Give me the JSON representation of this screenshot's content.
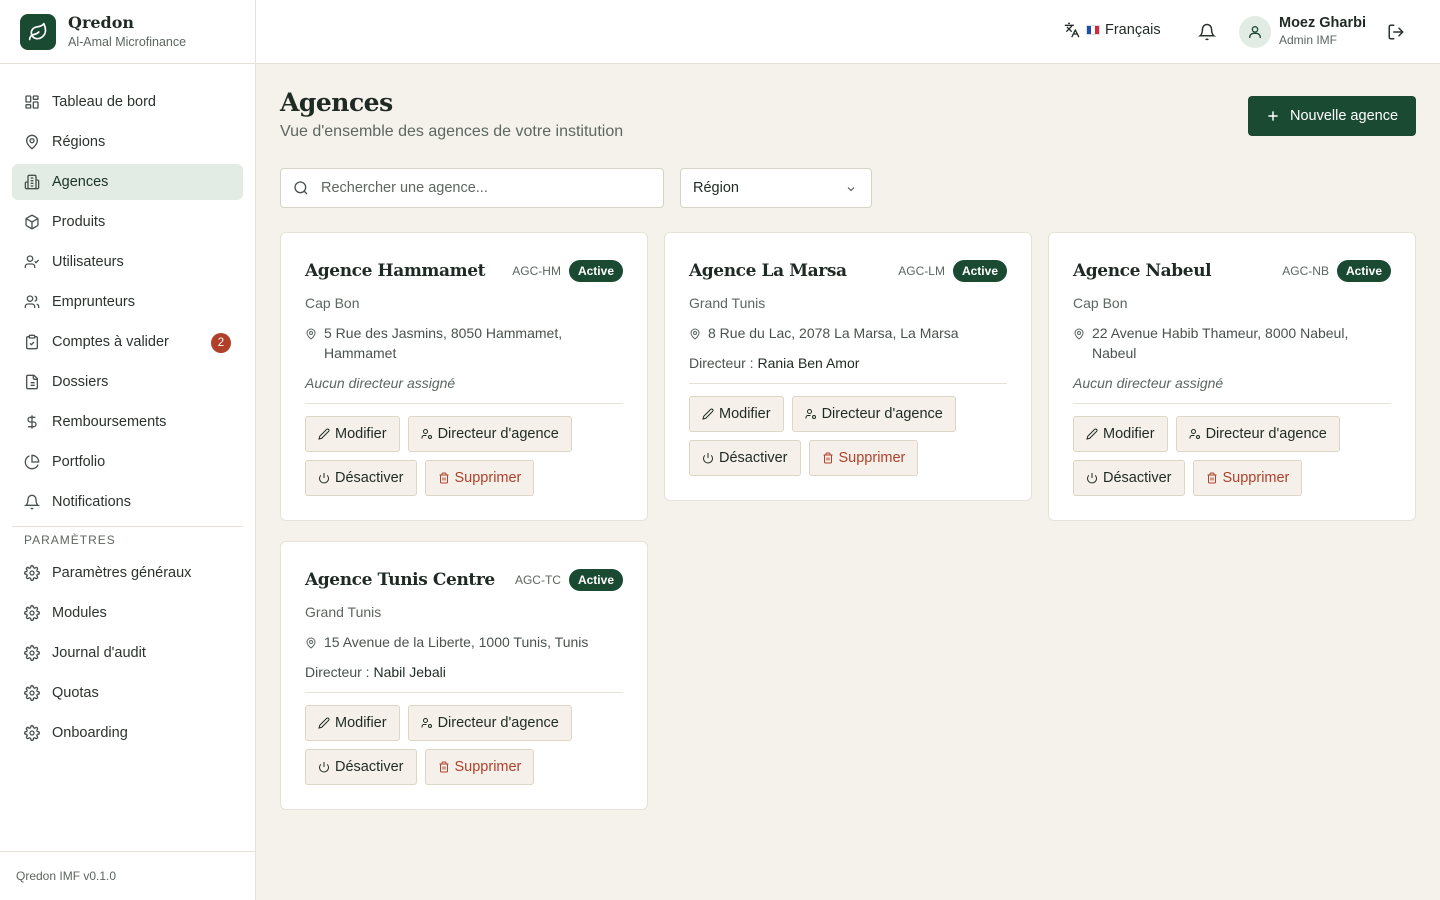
{
  "brand": {
    "name": "Qredon",
    "subtitle": "Al-Amal Microfinance"
  },
  "sidebar": {
    "items": [
      {
        "label": "Tableau de bord",
        "icon": "dashboard-icon"
      },
      {
        "label": "Régions",
        "icon": "map-pin-icon"
      },
      {
        "label": "Agences",
        "icon": "building-icon",
        "active": true
      },
      {
        "label": "Produits",
        "icon": "package-icon"
      },
      {
        "label": "Utilisateurs",
        "icon": "user-check-icon"
      },
      {
        "label": "Emprunteurs",
        "icon": "users-icon"
      },
      {
        "label": "Comptes à valider",
        "icon": "clipboard-check-icon",
        "badge": "2"
      },
      {
        "label": "Dossiers",
        "icon": "file-icon"
      },
      {
        "label": "Remboursements",
        "icon": "dollar-icon"
      },
      {
        "label": "Portfolio",
        "icon": "pie-chart-icon"
      },
      {
        "label": "Notifications",
        "icon": "bell-icon"
      }
    ],
    "settings_heading": "Paramètres",
    "settings_items": [
      {
        "label": "Paramètres généraux",
        "icon": "gear-icon"
      },
      {
        "label": "Modules",
        "icon": "gear-icon"
      },
      {
        "label": "Journal d'audit",
        "icon": "gear-icon"
      },
      {
        "label": "Quotas",
        "icon": "gear-icon"
      },
      {
        "label": "Onboarding",
        "icon": "gear-icon"
      }
    ],
    "footer": "Qredon IMF v0.1.0"
  },
  "topbar": {
    "language": "Français",
    "user_name": "Moez Gharbi",
    "user_role": "Admin IMF"
  },
  "page": {
    "title": "Agences",
    "subtitle": "Vue d'ensemble des agences de votre institution",
    "new_button": "Nouvelle agence",
    "search_placeholder": "Rechercher une agence...",
    "region_filter": "Région"
  },
  "actions": {
    "edit": "Modifier",
    "director": "Directeur d'agence",
    "deactivate": "Désactiver",
    "delete": "Supprimer"
  },
  "director_prefix": "Directeur :",
  "agencies": [
    {
      "name": "Agence Hammamet",
      "code": "AGC-HM",
      "status": "Active",
      "region": "Cap Bon",
      "address": "5 Rue des Jasmins, 8050 Hammamet, Hammamet",
      "director": null,
      "no_director": "Aucun directeur assigné"
    },
    {
      "name": "Agence La Marsa",
      "code": "AGC-LM",
      "status": "Active",
      "region": "Grand Tunis",
      "address": "8 Rue du Lac, 2078 La Marsa, La Marsa",
      "director": "Rania Ben Amor"
    },
    {
      "name": "Agence Nabeul",
      "code": "AGC-NB",
      "status": "Active",
      "region": "Cap Bon",
      "address": "22 Avenue Habib Thameur, 8000 Nabeul, Nabeul",
      "director": null,
      "no_director": "Aucun directeur assigné"
    },
    {
      "name": "Agence Tunis Centre",
      "code": "AGC-TC",
      "status": "Active",
      "region": "Grand Tunis",
      "address": "15 Avenue de la Liberte, 1000 Tunis, Tunis",
      "director": "Nabil Jebali"
    }
  ],
  "colors": {
    "primary": "#1b4a33",
    "danger": "#b0402a",
    "background": "#f5f2ec"
  }
}
